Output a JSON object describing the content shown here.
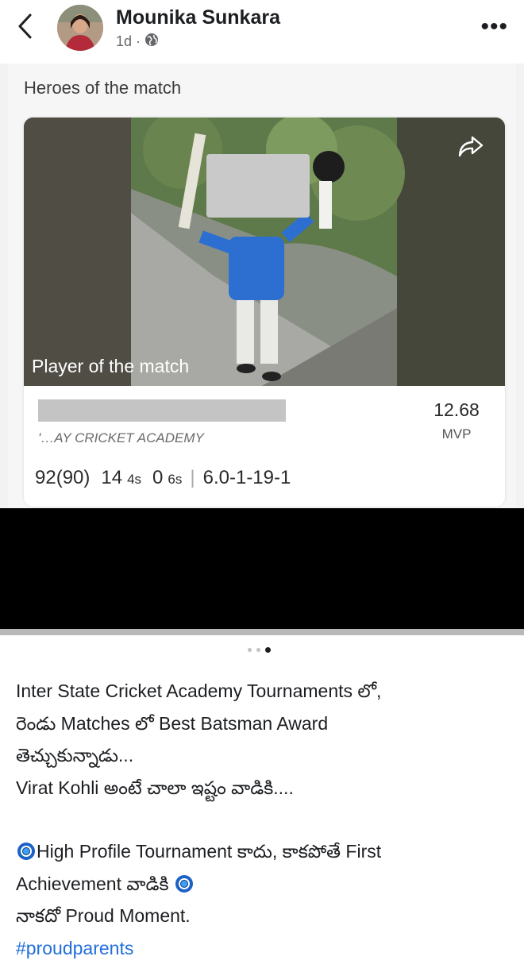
{
  "header": {
    "back_icon": "chevron-left-icon",
    "author_name": "Mounika Sunkara",
    "time_ago": "1d",
    "separator": "·",
    "privacy_icon": "globe-icon",
    "more_label": "•••"
  },
  "scorecard": {
    "section_title": "Heroes of the match",
    "photo_label": "Player of the match",
    "share_icon": "share-icon",
    "academy": "'…AY CRICKET ACADEMY",
    "mvp_value": "12.68",
    "mvp_label": "MVP",
    "runs": "92(90)",
    "fours_count": "14",
    "fours_label": "4s",
    "sixes_count": "0",
    "sixes_label": "6s",
    "bowling": "6.0-1-19-1"
  },
  "carousel": {
    "total": 3,
    "active": 3
  },
  "caption": {
    "line1": "Inter State Cricket Academy Tournaments లో,",
    "line2": "రెండు Matches లో Best Batsman Award",
    "line3": "తెచ్చుకున్నాడు...",
    "line4": "Virat Kohli అంటే చాలా ఇష్టం వాడికి....",
    "line5": "High Profile Tournament కాదు, కాకపోతే First",
    "line6": "Achievement వాడికి",
    "line7": "నాకదో  Proud Moment.",
    "hashtag": "#proudparents"
  },
  "colors": {
    "link": "#216fdb",
    "text": "#1c1e21",
    "meta": "#65676b"
  }
}
